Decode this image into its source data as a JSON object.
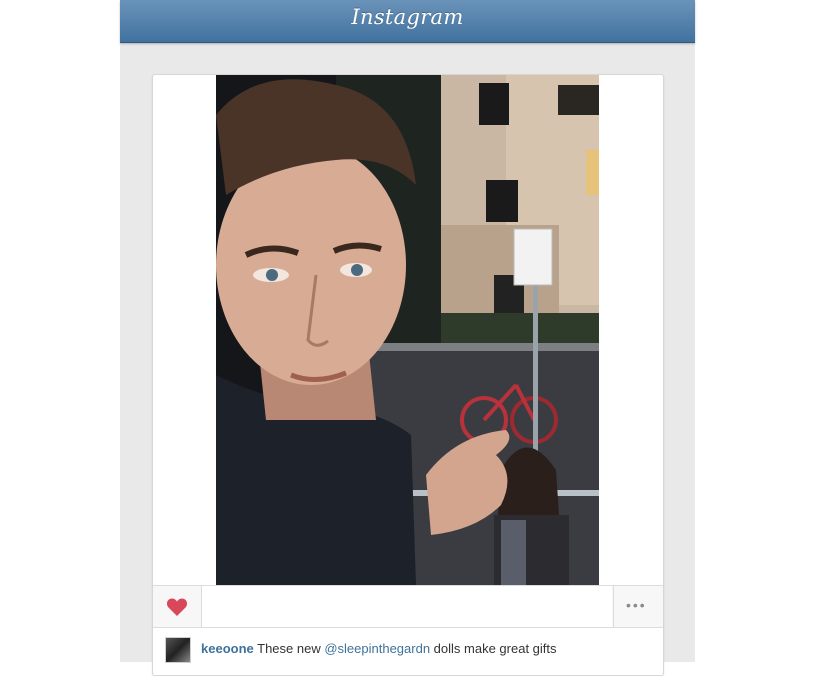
{
  "app": {
    "logo": "Instagram",
    "brand_color": "#41729f"
  },
  "post": {
    "photo_description_icon": "selfie-photo",
    "liked": true,
    "like_icon": "heart-icon",
    "like_color": "#d9475b",
    "more_icon": "ellipsis-icon",
    "more_label": "•••",
    "caption": {
      "username": "keeoone",
      "text_before": "These new ",
      "mention": "@sleepinthegardn",
      "text_after": " dolls make great gifts"
    }
  }
}
